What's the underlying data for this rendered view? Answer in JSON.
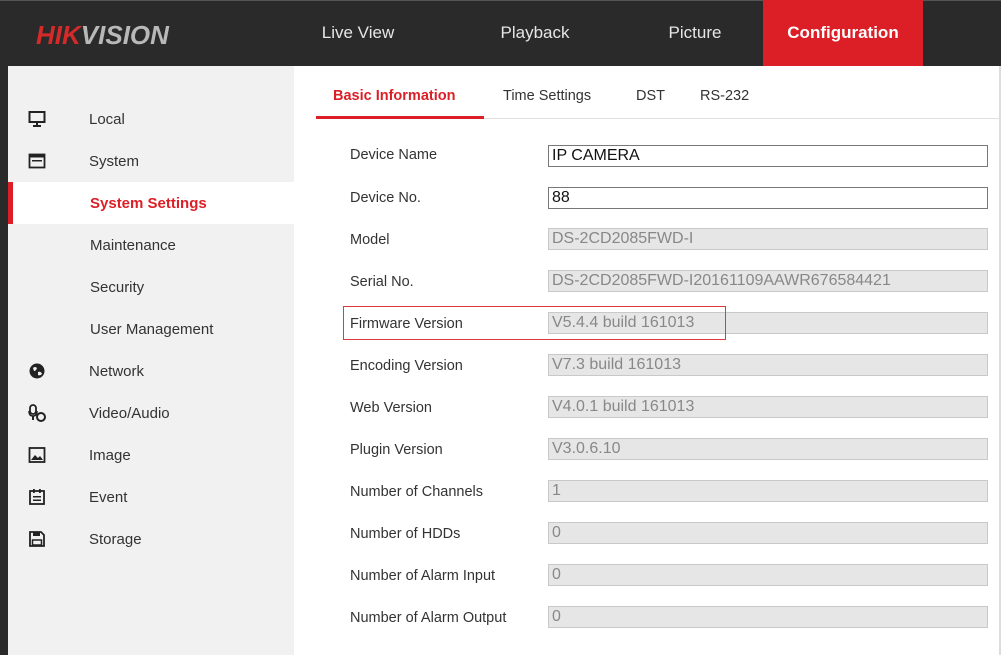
{
  "header": {
    "logo_red": "HIK",
    "logo_gray": "VISION",
    "nav": [
      {
        "label": "Live View"
      },
      {
        "label": "Playback"
      },
      {
        "label": "Picture"
      },
      {
        "label": "Configuration",
        "active": true
      }
    ]
  },
  "sidebar": {
    "items": [
      {
        "label": "Local",
        "icon": "monitor-icon"
      },
      {
        "label": "System",
        "icon": "system-icon"
      },
      {
        "label": "System Settings",
        "selected": true
      },
      {
        "label": "Maintenance"
      },
      {
        "label": "Security"
      },
      {
        "label": "User Management"
      },
      {
        "label": "Network",
        "icon": "globe-icon"
      },
      {
        "label": "Video/Audio",
        "icon": "video-audio-icon"
      },
      {
        "label": "Image",
        "icon": "image-icon"
      },
      {
        "label": "Event",
        "icon": "calendar-icon"
      },
      {
        "label": "Storage",
        "icon": "floppy-disk-icon"
      }
    ]
  },
  "tabs": [
    {
      "label": "Basic Information",
      "active": true
    },
    {
      "label": "Time Settings"
    },
    {
      "label": "DST"
    },
    {
      "label": "RS-232"
    }
  ],
  "form": {
    "device_name": {
      "label": "Device Name",
      "value": "IP CAMERA"
    },
    "device_no": {
      "label": "Device No.",
      "value": "88"
    },
    "model": {
      "label": "Model",
      "value": "DS-2CD2085FWD-I"
    },
    "serial_no": {
      "label": "Serial No.",
      "value": "DS-2CD2085FWD-I20161109AAWR676584421"
    },
    "firmware_version": {
      "label": "Firmware Version",
      "value": "V5.4.4 build 161013"
    },
    "encoding_version": {
      "label": "Encoding Version",
      "value": "V7.3 build 161013"
    },
    "web_version": {
      "label": "Web Version",
      "value": "V4.0.1 build 161013"
    },
    "plugin_version": {
      "label": "Plugin Version",
      "value": "V3.0.6.10"
    },
    "num_channels": {
      "label": "Number of Channels",
      "value": "1"
    },
    "num_hdds": {
      "label": "Number of HDDs",
      "value": "0"
    },
    "num_alarm_input": {
      "label": "Number of Alarm Input",
      "value": "0"
    },
    "num_alarm_output": {
      "label": "Number of Alarm Output",
      "value": "0"
    }
  },
  "colors": {
    "accent": "#dc1f26",
    "header_bg": "#2a2a2a",
    "sidebar_bg": "#f1f1f1",
    "highlight_box": "#e0383c"
  }
}
